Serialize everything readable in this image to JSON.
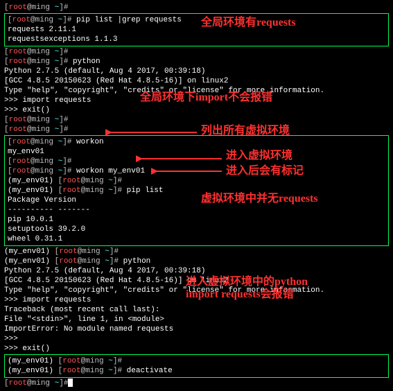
{
  "lines": {
    "l0": {
      "prompt_user": "root",
      "prompt_host": "@ming",
      "prompt_path": " ~",
      "prompt_end": "]#"
    },
    "l1": {
      "cmd": " pip list |grep requests"
    },
    "l2": "requests                  2.11.1",
    "l3": "requestsexceptions        1.1.3",
    "l4": {
      "cmd": ""
    },
    "l5": {
      "cmd": " python"
    },
    "l6": "Python 2.7.5 (default, Aug  4 2017, 00:39:18)",
    "l7": "[GCC 4.8.5 20150623 (Red Hat 4.8.5-16)] on linux2",
    "l8": "Type \"help\", \"copyright\", \"credits\" or \"license\" for more information.",
    "l9": ">>> import requests",
    "l10": ">>> exit()",
    "l11": {
      "cmd": ""
    },
    "l12": {
      "cmd": ""
    },
    "l13": {
      "cmd": " workon"
    },
    "l14": "my_env01",
    "l15": {
      "cmd": ""
    },
    "l16": {
      "cmd": " workon my_env01"
    },
    "l17_env": "(my_env01) ",
    "l17": {
      "cmd": ""
    },
    "l18": {
      "cmd": " pip list"
    },
    "l19": "Package    Version",
    "l20": "---------- -------",
    "l21": "pip        10.0.1",
    "l22": "setuptools 39.2.0",
    "l23": "wheel      0.31.1",
    "l24": {
      "cmd": ""
    },
    "l25": {
      "cmd": " python"
    },
    "l26": "Python 2.7.5 (default, Aug  4 2017, 00:39:18)",
    "l27": "[GCC 4.8.5 20150623 (Red Hat 4.8.5-16)] on linux2",
    "l28": "Type \"help\", \"copyright\", \"credits\" or \"license\" for more information.",
    "l29": ">>> import requests",
    "l30": "Traceback (most recent call last):",
    "l31": "  File \"<stdin>\", line 1, in <module>",
    "l32": "ImportError: No module named requests",
    "l33": ">>> ",
    "l34": ">>> exit()",
    "l35": {
      "cmd": ""
    },
    "l36": {
      "cmd": " deactivate"
    },
    "l37": {
      "cmd": ""
    }
  },
  "annot": {
    "a1": "全局环境有requests",
    "a2": "全局环境下import不会报错",
    "a3": "列出所有虚拟环境",
    "a4": "进入虚拟环境",
    "a5": "进入后会有标记",
    "a6": "虚拟环境中并无requests",
    "a7": "进入虚拟环境中的python",
    "a8": "import requests会报错"
  }
}
